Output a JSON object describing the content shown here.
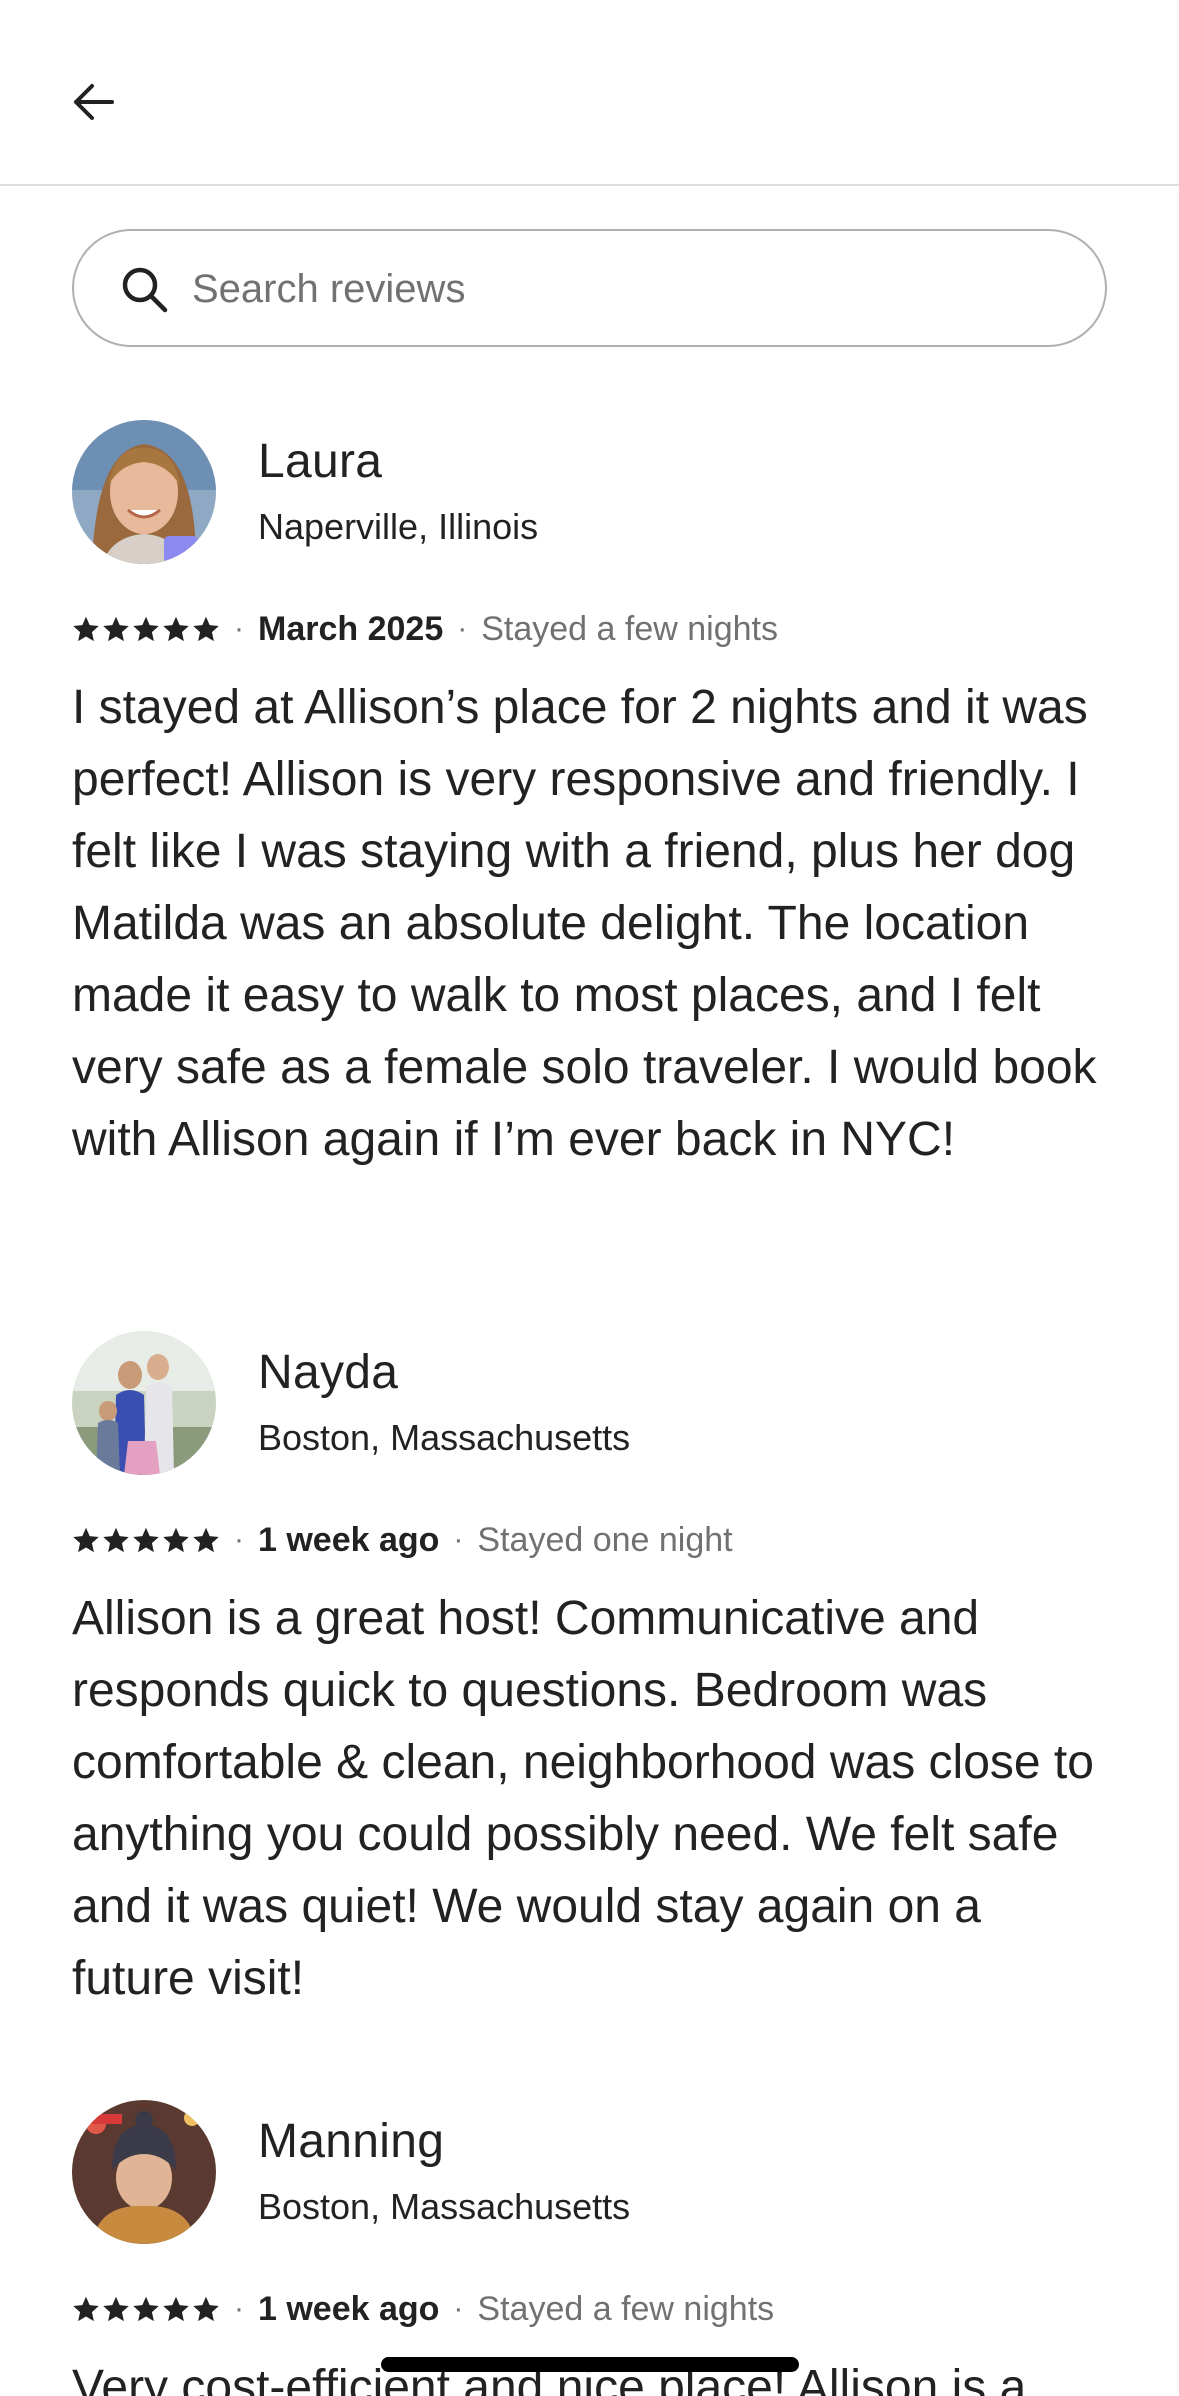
{
  "search": {
    "placeholder": "Search reviews"
  },
  "reviews": [
    {
      "name": "Laura",
      "location": "Naperville, Illinois",
      "rating": 5,
      "date": "March 2025",
      "stay": "Stayed a few nights",
      "text": "I stayed at Allison’s place for 2 nights and it was perfect! Allison is very responsive and friendly. I felt like I was staying with a friend, plus her dog Matilda was an absolute delight. The location made it easy to walk to most places, and I felt very safe as a female solo traveler. I would book with Allison again if I’m ever back in NYC!"
    },
    {
      "name": "Nayda",
      "location": "Boston, Massachusetts",
      "rating": 5,
      "date": "1 week ago",
      "stay": "Stayed one night",
      "text": "Allison is a great host! Communicative and responds quick to questions. Bedroom was comfortable & clean, neighborhood was close to anything you could possibly need. We felt safe and it was quiet! We would stay again on a future visit!"
    },
    {
      "name": "Manning",
      "location": "Boston, Massachusetts",
      "rating": 5,
      "date": "1 week ago",
      "stay": "Stayed a few nights",
      "text": "Very cost-efficient and nice place! Allison is a"
    }
  ],
  "colors": {
    "primary_text": "#222222",
    "secondary_text": "#717171",
    "divider": "#dddddd",
    "search_border": "#b0b0b0"
  },
  "icons": {
    "back": "arrow-left-icon",
    "search": "magnifier-icon",
    "star": "star-icon"
  }
}
